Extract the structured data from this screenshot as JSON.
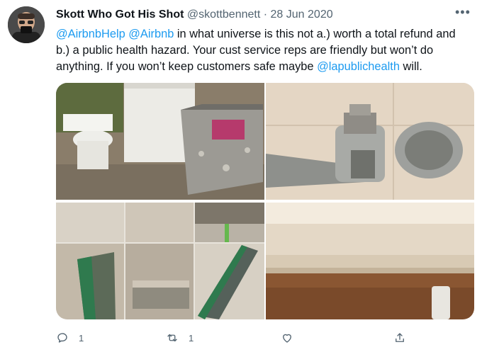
{
  "tweet": {
    "display_name": "Skott Who Got His Shot",
    "handle": "@skottbennett",
    "separator": "·",
    "date": "28 Jun 2020",
    "more_label": "•••",
    "text_parts": [
      {
        "type": "mention",
        "text": "@AirbnbHelp"
      },
      {
        "type": "text",
        "text": " "
      },
      {
        "type": "mention",
        "text": "@Airbnb"
      },
      {
        "type": "text",
        "text": " in what universe is this not a.) worth a total refund and b.) a public health hazard. Your cust service reps are friendly but won’t do anything. If you won’t keep customers safe maybe "
      },
      {
        "type": "mention",
        "text": "@lapublichealth"
      },
      {
        "type": "text",
        "text": " will."
      }
    ],
    "media": [
      {
        "name": "photo-toilet-and-debris"
      },
      {
        "name": "photo-faucet-closeup"
      },
      {
        "name": "photo-sponges-collage"
      },
      {
        "name": "photo-baseboard-closeup"
      }
    ],
    "actions": {
      "reply_count": "1",
      "retweet_count": "1",
      "like_count": "",
      "share_label": ""
    }
  },
  "colors": {
    "accent": "#1d9bf0",
    "text": "#0f1419",
    "muted": "#536471"
  }
}
